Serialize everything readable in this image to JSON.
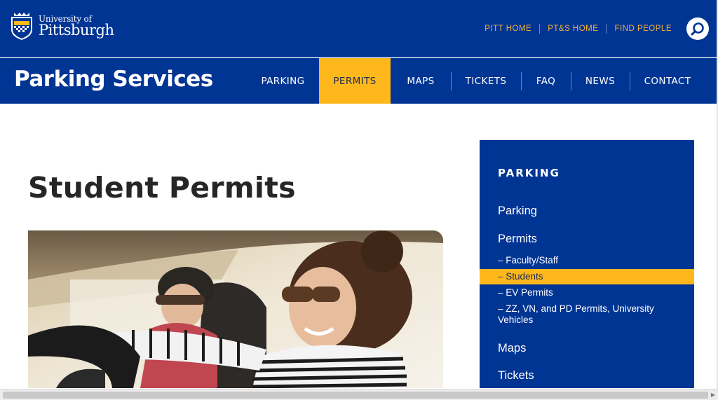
{
  "brand": {
    "small": "University of",
    "big": "Pittsburgh",
    "colors": {
      "blue": "#003594",
      "gold": "#ffb81c",
      "util_gold": "#f0b23b"
    }
  },
  "utility_nav": [
    "PITT HOME",
    "PT&S HOME",
    "FIND PEOPLE"
  ],
  "search": {
    "icon": "search-icon"
  },
  "site_title": "Parking Services",
  "main_nav": [
    {
      "label": "PARKING",
      "active": false
    },
    {
      "label": "PERMITS",
      "active": true
    },
    {
      "label": "MAPS",
      "active": false
    },
    {
      "label": "TICKETS",
      "active": false
    },
    {
      "label": "FAQ",
      "active": false
    },
    {
      "label": "NEWS",
      "active": false
    },
    {
      "label": "CONTACT",
      "active": false
    }
  ],
  "page": {
    "title": "Student Permits",
    "hero_image": "two women smiling in a car, driver wearing sunglasses and striped shirt"
  },
  "sidebar": {
    "heading": "PARKING",
    "links": {
      "parking": "Parking",
      "permits": "Permits",
      "maps": "Maps",
      "tickets": "Tickets"
    },
    "permit_subitems": [
      {
        "label": "– Faculty/Staff",
        "active": false
      },
      {
        "label": "– Students",
        "active": true
      },
      {
        "label": "– EV Permits",
        "active": false
      },
      {
        "label": "– ZZ, VN, and PD Permits, University Vehicles",
        "active": false
      }
    ]
  }
}
